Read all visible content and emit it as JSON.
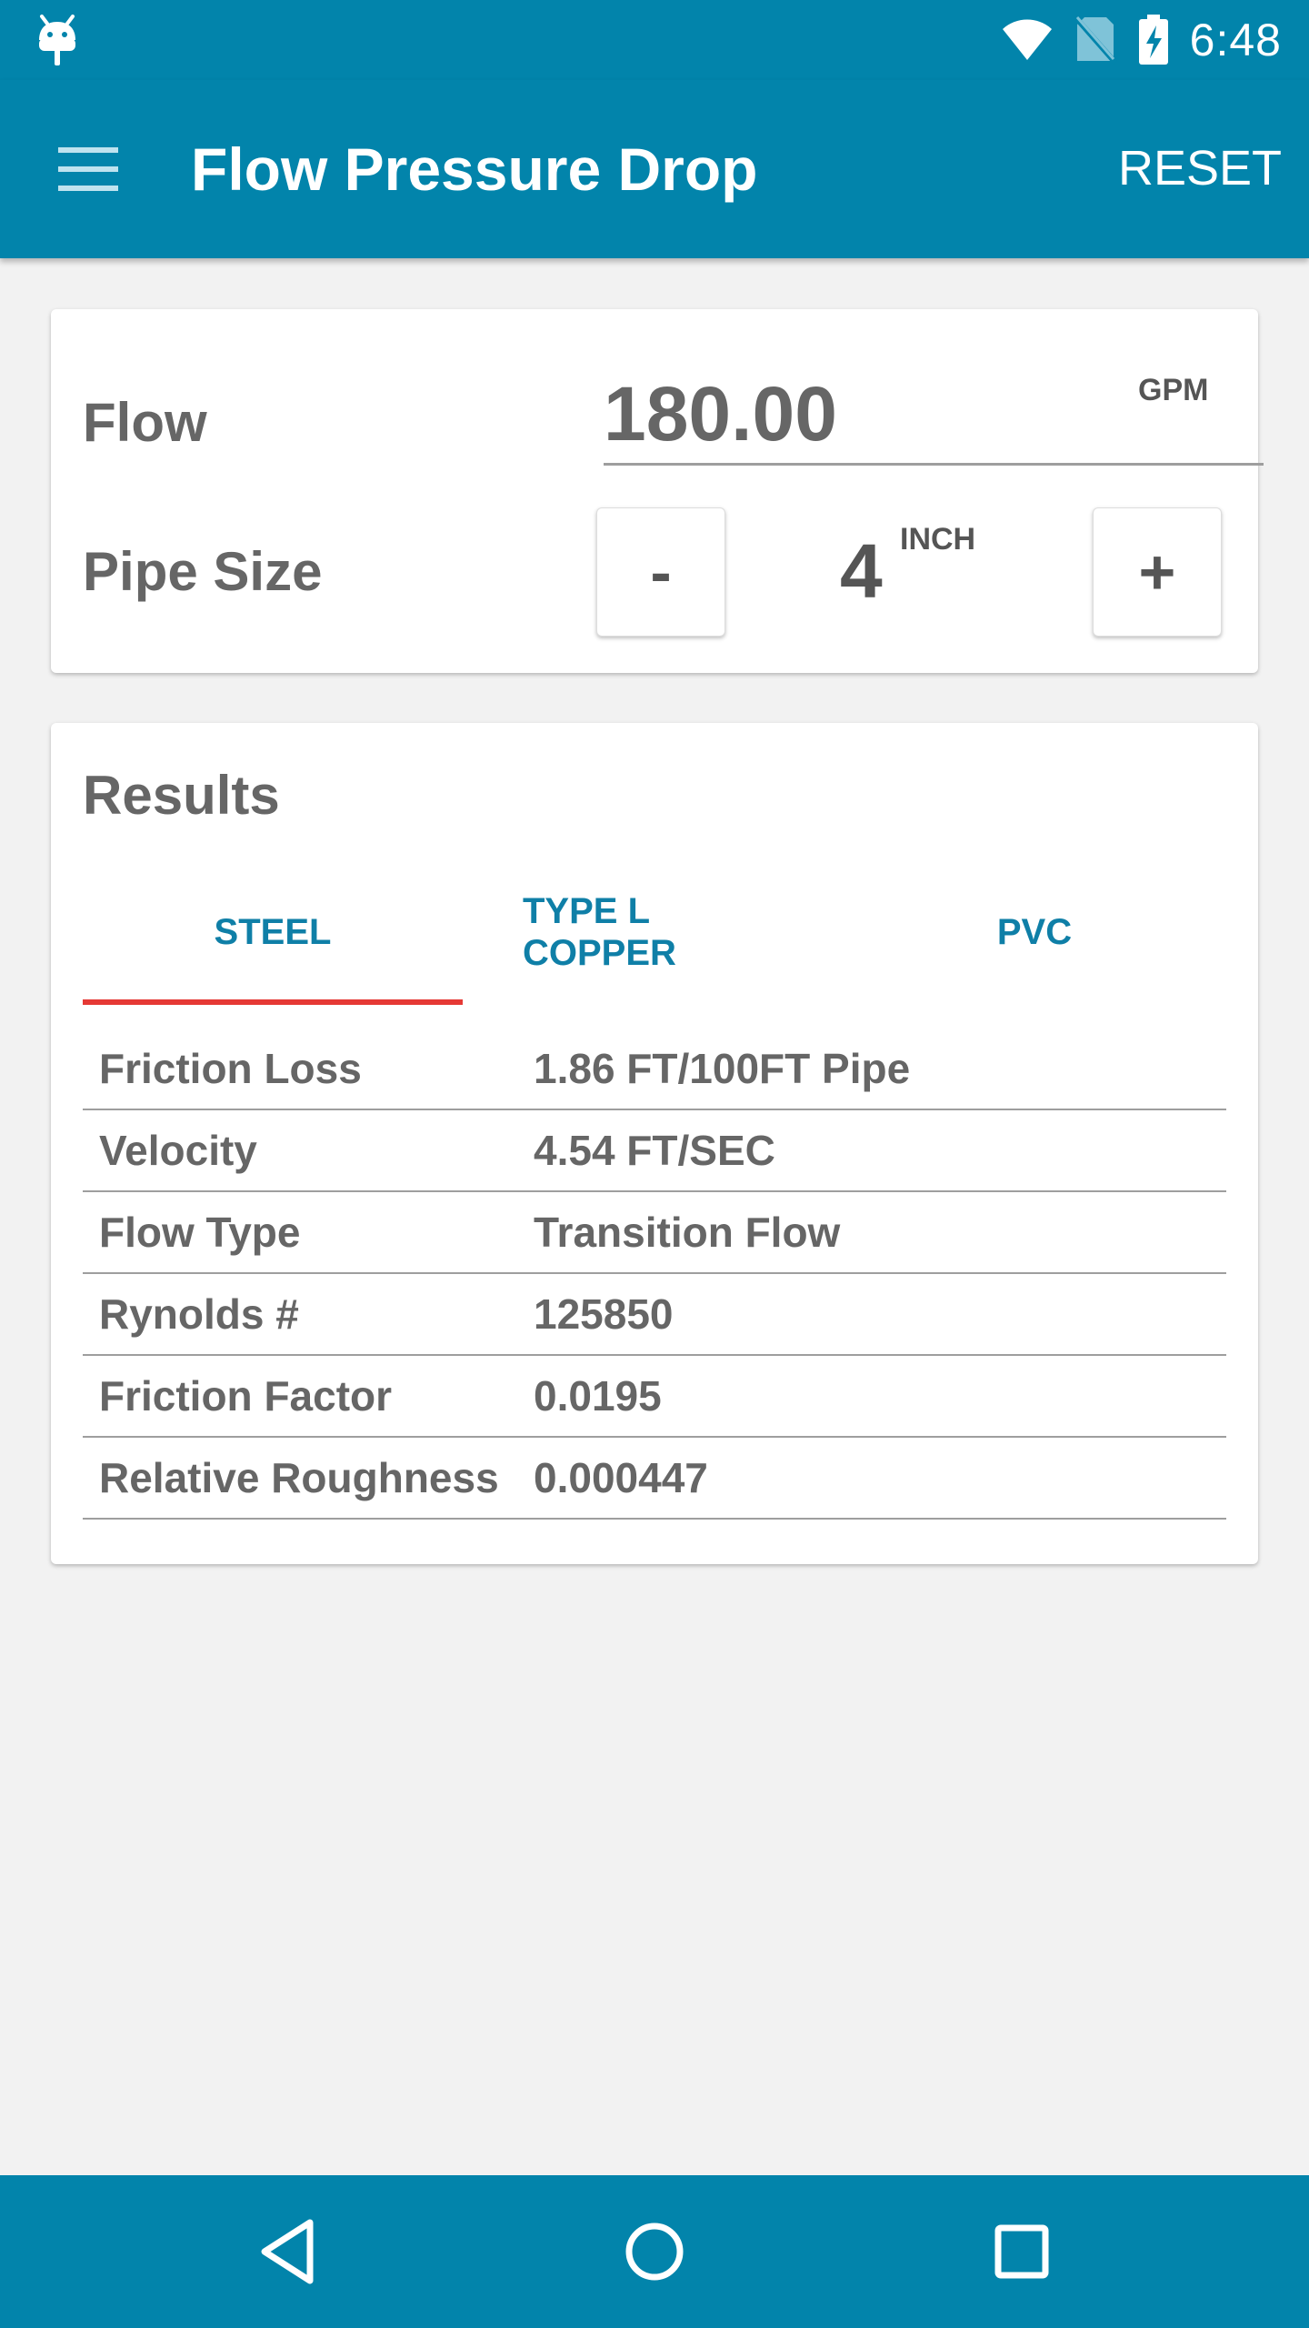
{
  "status_bar": {
    "time": "6:48",
    "left_icon": "android-debug-icon",
    "right_icons": [
      "wifi-icon",
      "no-sim-icon",
      "battery-charging-icon"
    ]
  },
  "app_bar": {
    "title": "Flow Pressure Drop",
    "reset_label": "RESET",
    "menu_icon": "hamburger-menu-icon"
  },
  "inputs": {
    "flow_label": "Flow",
    "flow_value": "180.00",
    "flow_unit": "GPM",
    "pipe_size_label": "Pipe Size",
    "pipe_size_value": "4",
    "pipe_size_unit": "INCH",
    "decrement_label": "-",
    "increment_label": "+"
  },
  "results": {
    "title": "Results",
    "tabs": [
      {
        "label": "STEEL",
        "selected": true
      },
      {
        "label": "TYPE L\nCOPPER",
        "selected": false
      },
      {
        "label": "PVC",
        "selected": false
      }
    ],
    "rows": [
      {
        "label": "Friction Loss",
        "value": "1.86 FT/100FT Pipe"
      },
      {
        "label": "Velocity",
        "value": "4.54 FT/SEC"
      },
      {
        "label": "Flow Type",
        "value": "Transition Flow"
      },
      {
        "label": "Rynolds #",
        "value": "125850"
      },
      {
        "label": "Friction Factor",
        "value": "0.0195"
      },
      {
        "label": "Relative Roughness",
        "value": "0.000447"
      }
    ]
  },
  "nav_bar": {
    "icons": [
      "back-icon",
      "home-icon",
      "recents-icon"
    ]
  },
  "colors": {
    "primary": "#0284ab",
    "tab_text": "#0f7fa7",
    "tab_indicator": "#e53935",
    "background": "#f2f2f2",
    "text": "#666666"
  }
}
